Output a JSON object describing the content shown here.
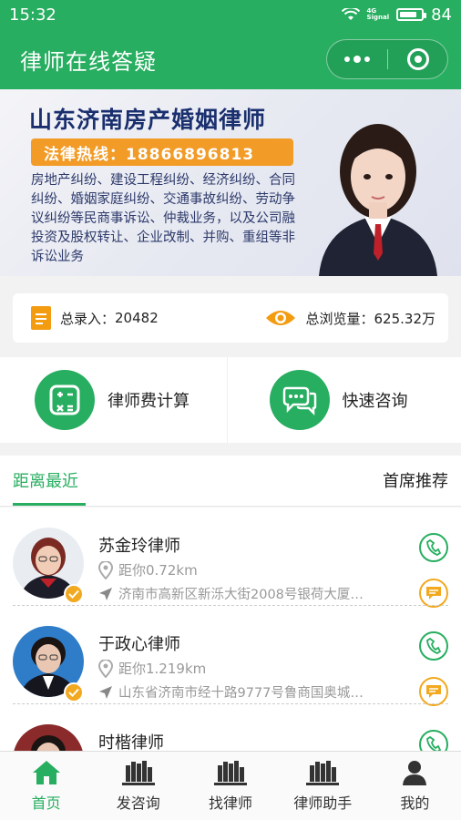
{
  "status_bar": {
    "time": "15:32",
    "network_label": "4G",
    "signal_label": "Signal",
    "battery": "84",
    "battery_level": 0.84
  },
  "nav": {
    "title": "律师在线答疑"
  },
  "banner": {
    "title": "山东济南房产婚姻律师",
    "hotline": "法律热线：18866896813",
    "description": "房地产纠纷、建设工程纠纷、经济纠纷、合同纠纷、婚姻家庭纠纷、交通事故纠纷、劳动争议纠纷等民商事诉讼、仲裁业务，以及公司融投资及股权转让、企业改制、并购、重组等非诉讼业务",
    "dot_count": 9,
    "active_dot": 3
  },
  "stats": {
    "total_entries_label": "总录入：",
    "total_entries_value": "20482",
    "total_views_label": "总浏览量：",
    "total_views_value": "625.32万"
  },
  "actions": [
    {
      "label": "律师费计算",
      "icon": "calculator-icon"
    },
    {
      "label": "快速咨询",
      "icon": "chat-bubbles-icon"
    }
  ],
  "tabs": {
    "nearest": "距离最近",
    "recommended": "首席推荐"
  },
  "lawyers": [
    {
      "name": "苏金玲律师",
      "distance": "距你0.72km",
      "address": "济南市高新区新泺大街2008号银荷大厦…"
    },
    {
      "name": "于政心律师",
      "distance": "距你1.219km",
      "address": "山东省济南市经十路9777号鲁商国奥城…"
    },
    {
      "name": "时楷律师",
      "distance": "",
      "address": ""
    }
  ],
  "tabbar": [
    {
      "label": "首页",
      "icon": "home-icon",
      "active": true
    },
    {
      "label": "发咨询",
      "icon": "books-icon",
      "active": false
    },
    {
      "label": "找律师",
      "icon": "books-icon",
      "active": false
    },
    {
      "label": "律师助手",
      "icon": "books-icon",
      "active": false
    },
    {
      "label": "我的",
      "icon": "user-icon",
      "active": false
    }
  ],
  "colors": {
    "brand_green": "#27ae60",
    "accent_orange": "#f2a91f"
  }
}
